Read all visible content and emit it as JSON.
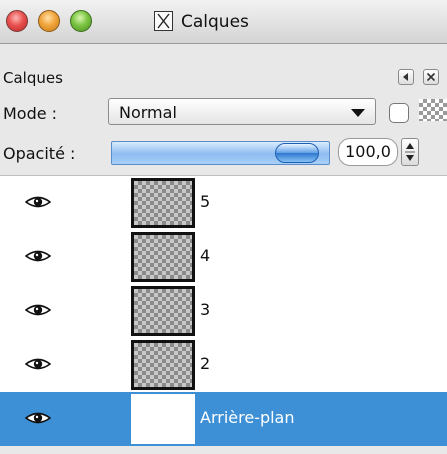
{
  "window": {
    "title": "Calques"
  },
  "dock": {
    "tab_label": "Calques"
  },
  "mode": {
    "label": "Mode :",
    "value": "Normal"
  },
  "opacity": {
    "label": "Opacité :",
    "value": "100,0",
    "fraction": 1.0
  },
  "layers": [
    {
      "name": "5",
      "visible": true,
      "selected": false
    },
    {
      "name": "4",
      "visible": true,
      "selected": false
    },
    {
      "name": "3",
      "visible": true,
      "selected": false
    },
    {
      "name": "2",
      "visible": true,
      "selected": false
    },
    {
      "name": "Arrière-plan",
      "visible": true,
      "selected": true
    }
  ],
  "colors": {
    "selection": "#3d8fd6",
    "close": "#e8504e",
    "minimize": "#f0a43b",
    "zoom": "#7bc442"
  },
  "icons": [
    "close-icon",
    "minimize-icon",
    "zoom-icon",
    "gimp-wilber-icon",
    "panel-menu-icon",
    "panel-close-icon",
    "chevron-down-icon",
    "lock-alpha-icon",
    "spinner-icon",
    "eye-icon"
  ]
}
